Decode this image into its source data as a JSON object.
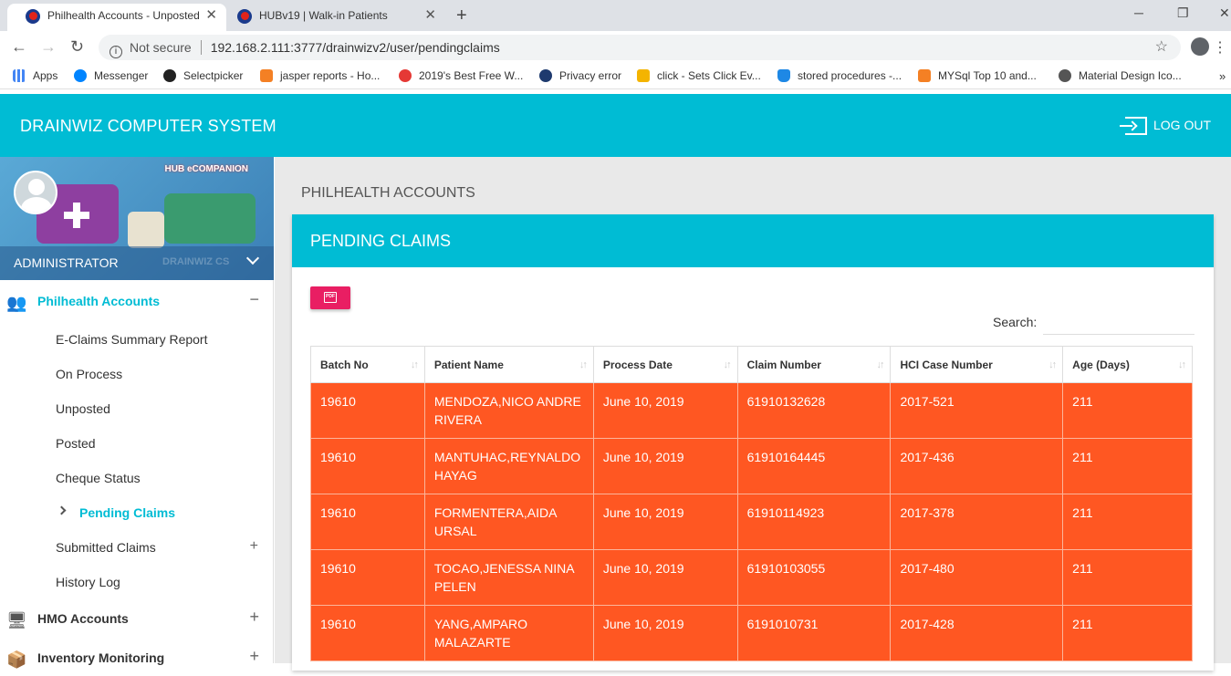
{
  "browser": {
    "tabs": [
      {
        "title": "Philhealth Accounts - Unposted",
        "active": true
      },
      {
        "title": "HUBv19 | Walk-in Patients",
        "active": false
      }
    ],
    "address": {
      "security": "Not secure",
      "url": "192.168.2.111:3777/drainwizv2/user/pendingclaims"
    },
    "bookmarks": [
      {
        "label": "Apps",
        "icon": "apps-grid-icon"
      },
      {
        "label": "Messenger",
        "icon": "messenger-icon"
      },
      {
        "label": "Selectpicker",
        "icon": "github-icon"
      },
      {
        "label": "jasper reports - Ho...",
        "icon": "stackoverflow-icon"
      },
      {
        "label": "2019's Best Free W...",
        "icon": "web-icon"
      },
      {
        "label": "Privacy error",
        "icon": "warning-globe-icon"
      },
      {
        "label": "click - Sets Click Ev...",
        "icon": "click-icon"
      },
      {
        "label": "stored procedures -...",
        "icon": "database-icon"
      },
      {
        "label": "MYSql Top 10 and...",
        "icon": "stackoverflow-icon"
      },
      {
        "label": "Material Design Ico...",
        "icon": "globe-icon"
      }
    ]
  },
  "header": {
    "brand": "DRAINWIZ COMPUTER SYSTEM",
    "logout_label": "LOG OUT"
  },
  "sidebar": {
    "banner_text": "HUB eCOMPANION",
    "role": "ADMINISTRATOR",
    "role_watermark": "DRAINWIZ CS",
    "groups": [
      {
        "label": "Philhealth Accounts",
        "expanded": true,
        "items": [
          {
            "label": "E-Claims Summary Report"
          },
          {
            "label": "On Process"
          },
          {
            "label": "Unposted"
          },
          {
            "label": "Posted"
          },
          {
            "label": "Cheque Status"
          },
          {
            "label": "Pending Claims",
            "active": true
          },
          {
            "label": "Submitted Claims",
            "has_children": true
          },
          {
            "label": "History Log"
          }
        ]
      },
      {
        "label": "HMO Accounts",
        "expanded": false
      },
      {
        "label": "Inventory Monitoring",
        "expanded": false
      }
    ]
  },
  "main": {
    "page_title": "PHILHEALTH ACCOUNTS",
    "card_title": "PENDING CLAIMS",
    "pdf_label": "PDF",
    "search_label": "Search:",
    "search_value": "",
    "columns": [
      "Batch No",
      "Patient Name",
      "Process Date",
      "Claim Number",
      "HCI Case Number",
      "Age (Days)"
    ],
    "rows": [
      [
        "19610",
        "MENDOZA,NICO ANDRE RIVERA",
        "June 10, 2019",
        "61910132628",
        "2017-521",
        "211"
      ],
      [
        "19610",
        "MANTUHAC,REYNALDO HAYAG",
        "June 10, 2019",
        "61910164445",
        "2017-436",
        "211"
      ],
      [
        "19610",
        "FORMENTERA,AIDA URSAL",
        "June 10, 2019",
        "61910114923",
        "2017-378",
        "211"
      ],
      [
        "19610",
        "TOCAO,JENESSA NINA PELEN",
        "June 10, 2019",
        "61910103055",
        "2017-480",
        "211"
      ],
      [
        "19610",
        "YANG,AMPARO MALAZARTE",
        "June 10, 2019",
        "6191010731",
        "2017-428",
        "211"
      ]
    ]
  },
  "colors": {
    "primary": "#00bcd4",
    "row_highlight": "#ff5722",
    "pdf_button": "#e91e63"
  }
}
